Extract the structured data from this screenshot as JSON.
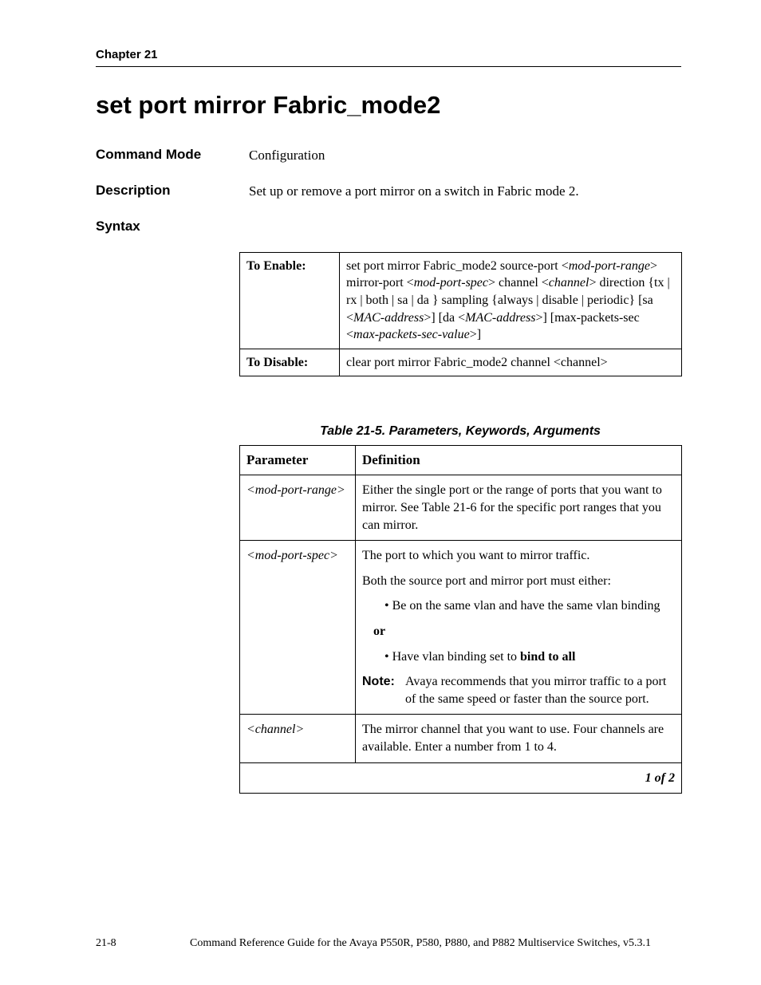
{
  "header": {
    "chapter": "Chapter 21"
  },
  "title": "set port mirror Fabric_mode2",
  "sections": {
    "command_mode": {
      "label": "Command Mode",
      "value": "Configuration"
    },
    "description": {
      "label": "Description",
      "value": "Set up or remove a port mirror on a switch in Fabric mode 2."
    },
    "syntax": {
      "label": "Syntax"
    }
  },
  "syntax_table": {
    "enable": {
      "label": "To Enable:",
      "text": "set port mirror Fabric_mode2 source-port <mod-port-range> mirror-port <mod-port-spec> channel <channel> direction {tx | rx | both | sa | da } sampling {always | disable | periodic} [sa <MAC-address>] [da <MAC-address>] [max-packets-sec <max-packets-sec-value>]"
    },
    "disable": {
      "label": "To Disable:",
      "text": "clear port mirror Fabric_mode2 channel <channel>"
    }
  },
  "params_table": {
    "caption": "Table 21-5.  Parameters, Keywords, Arguments",
    "headers": {
      "param": "Parameter",
      "def": "Definition"
    },
    "rows": [
      {
        "param": "<mod-port-range>",
        "def_plain": "Either the single port or the range of ports that you want to mirror. See Table 21-6 for the specific port ranges that you can mirror."
      },
      {
        "param": "<mod-port-spec>",
        "def_l1": "The port to which you want to mirror traffic.",
        "def_l2": "Both the source port and mirror port must either:",
        "bullet1": "Be on the same vlan and have the same vlan binding",
        "or": "or",
        "bullet2_pre": "Have vlan binding set to ",
        "bullet2_bold": "bind to all",
        "note_label": "Note:",
        "note_body": "Avaya recommends that you mirror traffic to a port of the same speed or faster than the source port."
      },
      {
        "param": "<channel>",
        "def_plain": "The mirror channel that you want to use. Four channels are available. Enter a number from 1 to 4."
      }
    ],
    "paging": "1 of 2"
  },
  "footer": {
    "page_number": "21-8",
    "text": "Command Reference Guide for the Avaya P550R, P580, P880, and P882 Multiservice Switches, v5.3.1"
  }
}
